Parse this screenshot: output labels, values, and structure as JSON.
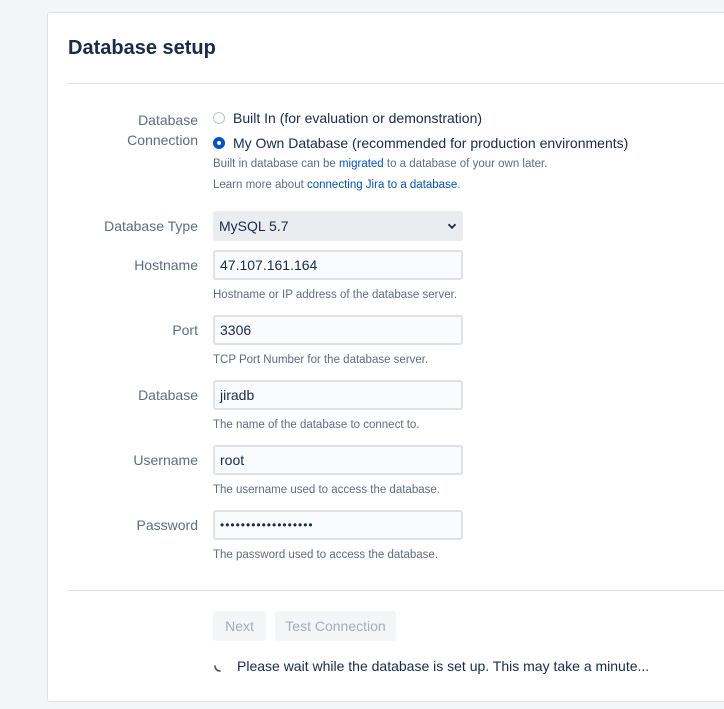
{
  "page": {
    "title": "Database setup"
  },
  "connection": {
    "label_line1": "Database",
    "label_line2": "Connection",
    "options": [
      {
        "label": "Built In (for evaluation or demonstration)",
        "checked": false
      },
      {
        "label": "My Own Database (recommended for production environments)",
        "checked": true
      }
    ],
    "hint1_prefix": "Built in database can be ",
    "hint1_link": "migrated",
    "hint1_suffix": " to a database of your own later.",
    "hint2_prefix": "Learn more about ",
    "hint2_link": "connecting Jira to a database",
    "hint2_suffix": "."
  },
  "fields": {
    "type": {
      "label": "Database Type",
      "value": "MySQL 5.7"
    },
    "hostname": {
      "label": "Hostname",
      "value": "47.107.161.164",
      "hint": "Hostname or IP address of the database server."
    },
    "port": {
      "label": "Port",
      "value": "3306",
      "hint": "TCP Port Number for the database server."
    },
    "database": {
      "label": "Database",
      "value": "jiradb",
      "hint": "The name of the database to connect to."
    },
    "username": {
      "label": "Username",
      "value": "root",
      "hint": "The username used to access the database."
    },
    "password": {
      "label": "Password",
      "value": "••••••••••••••••••",
      "hint": "The password used to access the database."
    }
  },
  "actions": {
    "next_label": "Next",
    "test_label": "Test Connection",
    "wait_message": "Please wait while the database is set up. This may take a minute..."
  },
  "colors": {
    "accent": "#0052cc",
    "text": "#172b4d",
    "muted": "#5e6c84",
    "disabled": "#a5adba"
  },
  "icons": {
    "select": "chevron-down-icon",
    "loading": "spinner-icon"
  }
}
